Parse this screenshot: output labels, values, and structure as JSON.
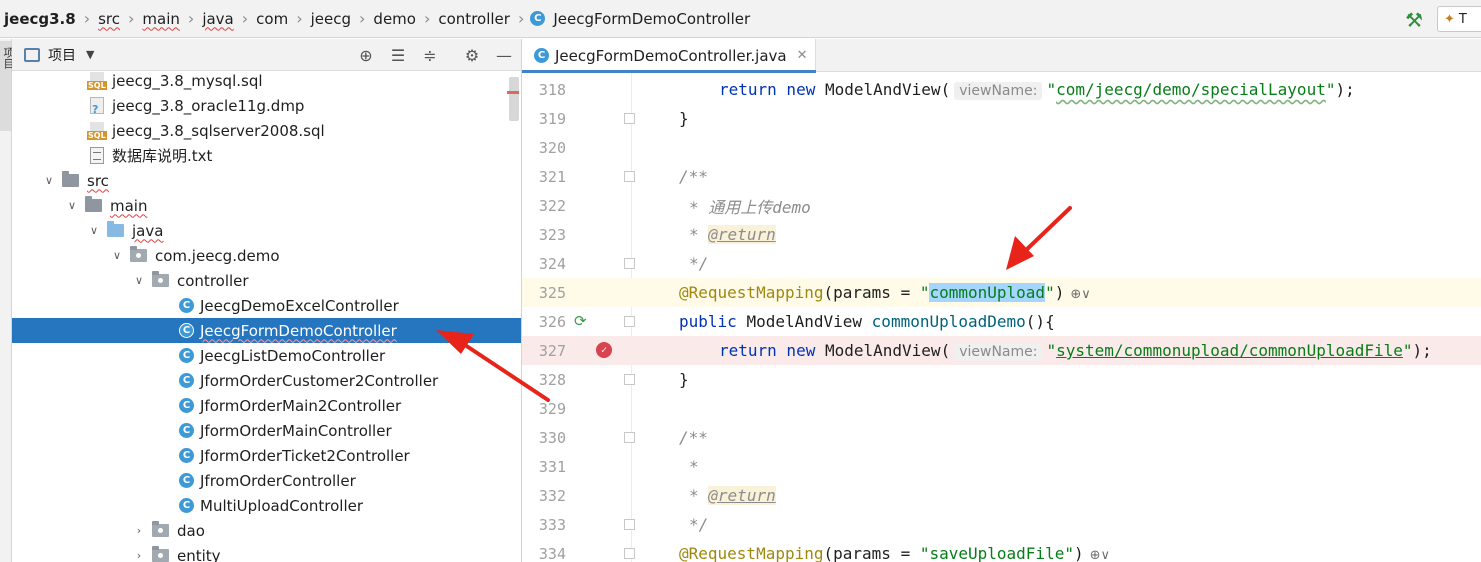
{
  "breadcrumb": {
    "items": [
      "jeecg3.8",
      "src",
      "main",
      "java",
      "com",
      "jeecg",
      "demo",
      "controller",
      "JeecgFormDemoController"
    ]
  },
  "toolbar": {
    "run_config_label": "T",
    "build_icon": "hammer-icon"
  },
  "left_strip": {
    "tab_label": "项目"
  },
  "project_panel": {
    "title": "项目",
    "tools": [
      "locate-icon",
      "expand-all-icon",
      "collapse-all-icon",
      "gear-icon",
      "minimize-icon"
    ],
    "tree": [
      {
        "label": "jeecg_3.8_mysql.sql",
        "icon": "sql-file-icon"
      },
      {
        "label": "jeecg_3.8_oracle11g.dmp",
        "icon": "unknown-file-icon"
      },
      {
        "label": "jeecg_3.8_sqlserver2008.sql",
        "icon": "sql-file-icon"
      },
      {
        "label": "数据库说明.txt",
        "icon": "text-file-icon"
      },
      {
        "label": "src",
        "icon": "folder-icon",
        "expanded": true
      },
      {
        "label": "main",
        "icon": "folder-icon",
        "expanded": true
      },
      {
        "label": "java",
        "icon": "source-folder-icon",
        "expanded": true
      },
      {
        "label": "com.jeecg.demo",
        "icon": "package-icon",
        "expanded": true
      },
      {
        "label": "controller",
        "icon": "package-icon",
        "expanded": true
      },
      {
        "label": "JeecgDemoExcelController",
        "icon": "class-icon"
      },
      {
        "label": "JeecgFormDemoController",
        "icon": "class-icon",
        "selected": true
      },
      {
        "label": "JeecgListDemoController",
        "icon": "class-icon"
      },
      {
        "label": "JformOrderCustomer2Controller",
        "icon": "class-icon"
      },
      {
        "label": "JformOrderMain2Controller",
        "icon": "class-icon"
      },
      {
        "label": "JformOrderMainController",
        "icon": "class-icon"
      },
      {
        "label": "JformOrderTicket2Controller",
        "icon": "class-icon"
      },
      {
        "label": "JfromOrderController",
        "icon": "class-icon"
      },
      {
        "label": "MultiUploadController",
        "icon": "class-icon"
      },
      {
        "label": "dao",
        "icon": "package-icon",
        "expanded": false
      },
      {
        "label": "entity",
        "icon": "package-icon",
        "expanded": false
      }
    ]
  },
  "editor": {
    "tab_label": "JeecgFormDemoController.java",
    "class_icon_letter": "C",
    "lines": [
      {
        "n": "318"
      },
      {
        "n": "319"
      },
      {
        "n": "320"
      },
      {
        "n": "321"
      },
      {
        "n": "322"
      },
      {
        "n": "323"
      },
      {
        "n": "324"
      },
      {
        "n": "325"
      },
      {
        "n": "326"
      },
      {
        "n": "327"
      },
      {
        "n": "328"
      },
      {
        "n": "329"
      },
      {
        "n": "330"
      },
      {
        "n": "331"
      },
      {
        "n": "332"
      },
      {
        "n": "333"
      },
      {
        "n": "334"
      }
    ],
    "code": {
      "l318_kw": "return new",
      "l318_cls": "ModelAndView(",
      "l318_hint": "viewName:",
      "l318_str": "com/jeecg/demo/specialLayout",
      "l319": "}",
      "l321": "/**",
      "l322": "* 通用上传demo",
      "l323_star": "*",
      "l323_tag": "@return",
      "l324": "*/",
      "l325_ann": "@RequestMapping",
      "l325_paren": "(params = ",
      "l325_str": "commonUpload",
      "l326_kw": "public",
      "l326_text": "ModelAndView",
      "l326_method": "commonUploadDemo",
      "l326_tail": "(){",
      "l327_kw": "return new",
      "l327_cls": "ModelAndView(",
      "l327_hint": "viewName:",
      "l327_str": "system/commonupload/commonUploadFile",
      "l328": "}",
      "l330": "/**",
      "l331": "*",
      "l332_star": "*",
      "l332_tag": "@return",
      "l333": "*/",
      "l334_ann": "@RequestMapping",
      "l334_paren": "(params = ",
      "l334_str": "saveUploadFile"
    }
  },
  "colors": {
    "selection": "#2675bf",
    "keyword": "#0033b3",
    "annotation": "#9e880d",
    "string": "#067d17",
    "comment": "#8c8c8c",
    "arrow": "#e8231a"
  }
}
